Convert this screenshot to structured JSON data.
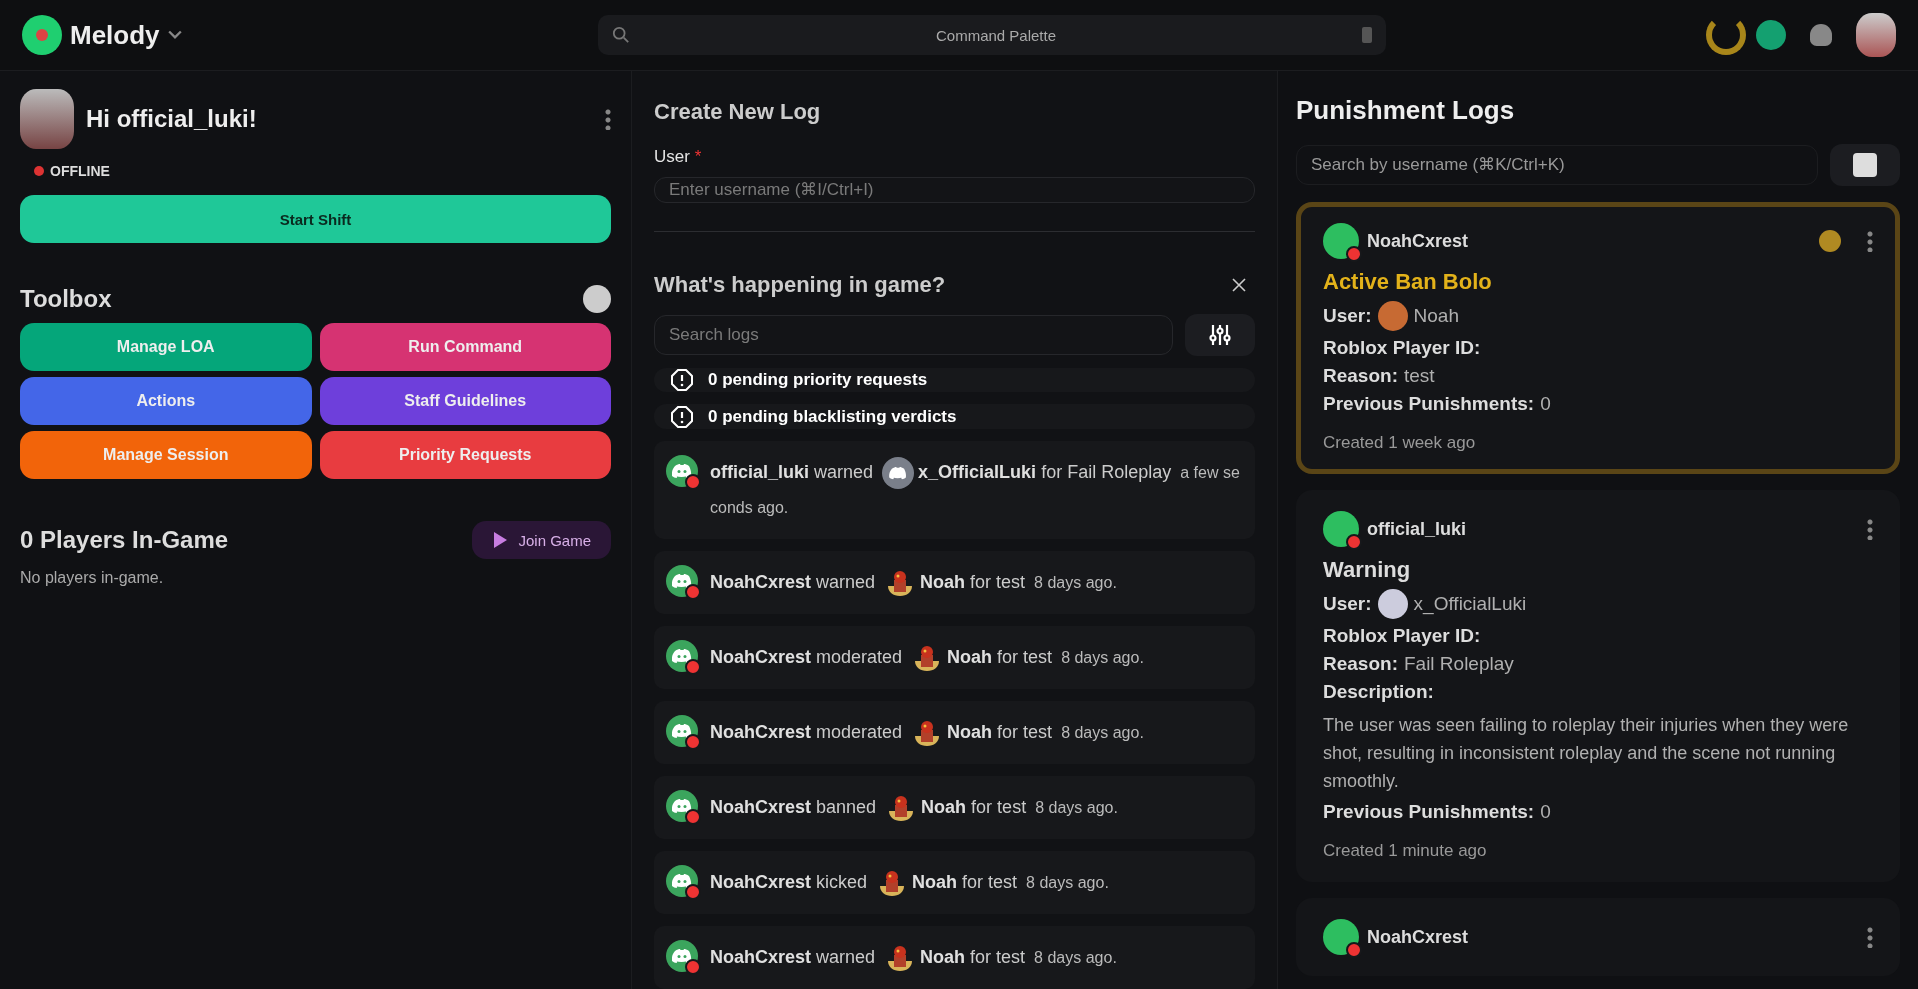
{
  "topbar": {
    "brand": "Melody",
    "command_palette": {
      "placeholder": "Command Palette"
    }
  },
  "profile": {
    "greeting": "Hi official_luki!",
    "status": "OFFLINE",
    "shift_button": "Start Shift"
  },
  "toolbox": {
    "title": "Toolbox",
    "buttons": [
      {
        "label": "Manage LOA",
        "color": "#05a67a"
      },
      {
        "label": "Run Command",
        "color": "#d63372"
      },
      {
        "label": "Actions",
        "color": "#4466e8"
      },
      {
        "label": "Staff Guidelines",
        "color": "#6e3fdb"
      },
      {
        "label": "Manage Session",
        "color": "#f2640a"
      },
      {
        "label": "Priority Requests",
        "color": "#e83c40"
      }
    ]
  },
  "players": {
    "title": "0 Players In-Game",
    "join_button": "Join Game",
    "empty": "No players in-game."
  },
  "create_log": {
    "title": "Create New Log",
    "user_label": "User",
    "required_mark": "*",
    "user_field": {
      "placeholder": "Enter username (⌘I/Ctrl+I)"
    }
  },
  "feed": {
    "title": "What's happening in game?",
    "search": {
      "placeholder": "Search logs"
    },
    "notices": [
      {
        "text": "0 pending priority requests"
      },
      {
        "text": "0 pending blacklisting verdicts"
      }
    ],
    "entries": [
      {
        "actor": "official_luki",
        "action": "warned",
        "target": "x_OfficialLuki",
        "kind": "discord",
        "for": "for",
        "reason": "Fail Roleplay",
        "time": "a few seconds ago."
      },
      {
        "actor": "NoahCxrest",
        "action": "warned",
        "target": "Noah",
        "kind": "roblox",
        "for": "for",
        "reason": "test",
        "time": "8 days ago."
      },
      {
        "actor": "NoahCxrest",
        "action": "moderated",
        "target": "Noah",
        "kind": "roblox",
        "for": "for",
        "reason": "test",
        "time": "8 days ago."
      },
      {
        "actor": "NoahCxrest",
        "action": "moderated",
        "target": "Noah",
        "kind": "roblox",
        "for": "for",
        "reason": "test",
        "time": "8 days ago."
      },
      {
        "actor": "NoahCxrest",
        "action": "banned",
        "target": "Noah",
        "kind": "roblox",
        "for": "for",
        "reason": "test",
        "time": "8 days ago."
      },
      {
        "actor": "NoahCxrest",
        "action": "kicked",
        "target": "Noah",
        "kind": "roblox",
        "for": "for",
        "reason": "test",
        "time": "8 days ago."
      },
      {
        "actor": "NoahCxrest",
        "action": "warned",
        "target": "Noah",
        "kind": "roblox",
        "for": "for",
        "reason": "test",
        "time": "8 days ago."
      }
    ]
  },
  "punishments": {
    "title": "Punishment Logs",
    "search": {
      "placeholder": "Search by username (⌘K/Ctrl+K)"
    },
    "cards": [
      {
        "author": "NoahCxrest",
        "highlighted": true,
        "type": "Active Ban Bolo",
        "fields": [
          {
            "kind": "roblox_user",
            "label": "User:",
            "value": "Noah"
          },
          {
            "kind": "text",
            "label": "Roblox Player ID:"
          },
          {
            "kind": "text",
            "label": "Reason:",
            "value": "test"
          },
          {
            "kind": "text",
            "label": "Previous Punishments:",
            "value": "0"
          }
        ],
        "created": "Created 1 week ago"
      },
      {
        "author": "official_luki",
        "highlighted": false,
        "type": "Warning",
        "fields": [
          {
            "kind": "discord_user",
            "label": "User:",
            "value": "x_OfficialLuki"
          },
          {
            "kind": "text",
            "label": "Roblox Player ID:"
          },
          {
            "kind": "text",
            "label": "Reason:",
            "value": "Fail Roleplay"
          },
          {
            "kind": "heading",
            "label": "Description:"
          },
          {
            "kind": "paragraph",
            "value": "The user was seen failing to roleplay their injuries when they were shot, resulting in inconsistent roleplay and the scene not running smoothly."
          },
          {
            "kind": "text",
            "label": "Previous Punishments:",
            "value": "0"
          }
        ],
        "created": "Created 1 minute ago"
      },
      {
        "author": "NoahCxrest",
        "highlighted": false
      }
    ]
  }
}
